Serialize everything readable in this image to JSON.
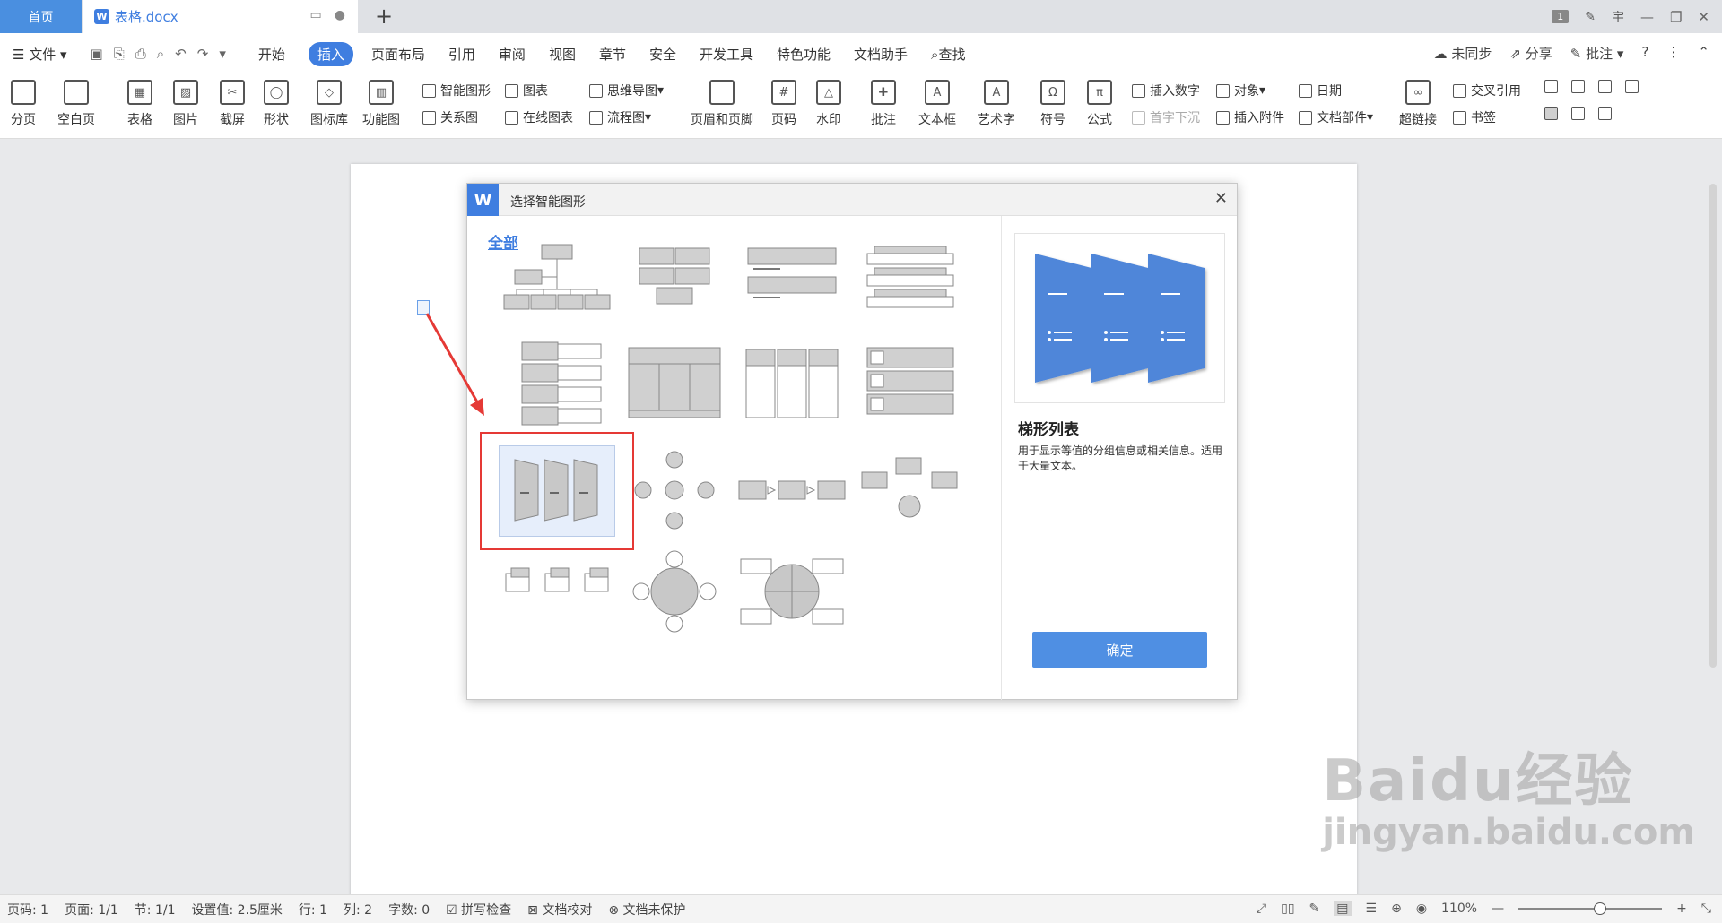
{
  "tabbar": {
    "home_label": "首页",
    "doc_title": "表格.docx",
    "page_badge": "1",
    "user": "宇",
    "icons": [
      "present-icon",
      "dot-icon",
      "add-tab-icon",
      "pen-icon",
      "minimize-icon",
      "restore-icon",
      "close-icon"
    ]
  },
  "menubar": {
    "file_label": "文件",
    "items": [
      "开始",
      "插入",
      "页面布局",
      "引用",
      "审阅",
      "视图",
      "章节",
      "安全",
      "开发工具",
      "特色功能",
      "文档助手"
    ],
    "active": "插入",
    "search_label": "查找",
    "sync_label": "未同步",
    "share_label": "分享",
    "comment_label": "批注"
  },
  "ribbon": {
    "large": [
      "分页",
      "空白页",
      "表格",
      "图片",
      "截屏",
      "形状",
      "图标库",
      "功能图",
      "页眉和页脚",
      "页码",
      "水印",
      "批注",
      "文本框",
      "艺术字",
      "符号",
      "公式",
      "超链接"
    ],
    "small": [
      "智能图形",
      "图表",
      "思维导图",
      "关系图",
      "在线图表",
      "流程图",
      "插入数字",
      "对象",
      "日期",
      "首字下沉",
      "插入附件",
      "文档部件",
      "交叉引用",
      "书签"
    ],
    "accent": "#3f7ee0"
  },
  "dialog": {
    "title": "选择智能图形",
    "category": "全部",
    "preview_name": "梯形列表",
    "preview_desc": "用于显示等值的分组信息或相关信息。适用于大量文本。",
    "ok_label": "确定"
  },
  "statusbar": {
    "page": "页码: 1",
    "pages": "页面: 1/1",
    "section": "节: 1/1",
    "setting": "设置值: 2.5厘米",
    "row": "行: 1",
    "col": "列: 2",
    "wordcount": "字数: 0",
    "spellcheck": "拼写检查",
    "proofread": "文档校对",
    "protect": "文档未保护",
    "zoom": "110%"
  },
  "watermark": {
    "main": "Baidu经验",
    "sub": "jingyan.baidu.com"
  }
}
